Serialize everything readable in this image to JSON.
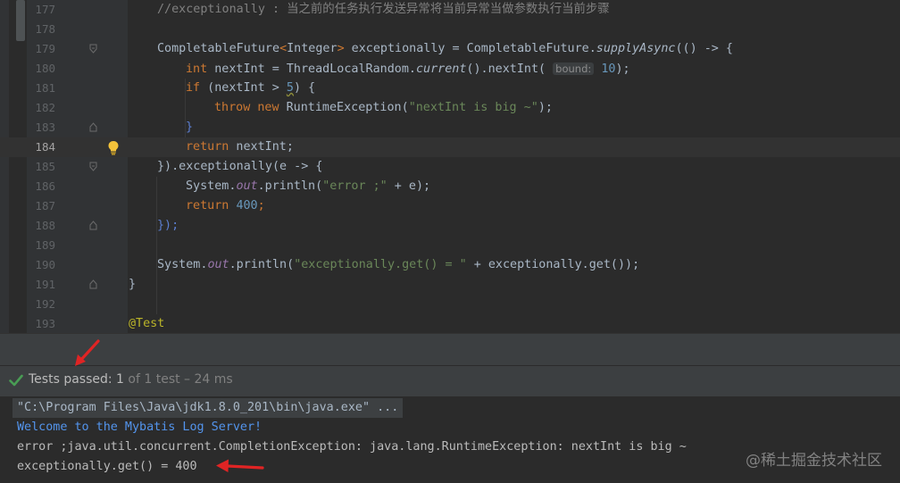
{
  "editor": {
    "lines": [
      {
        "num": "177"
      },
      {
        "num": "178"
      },
      {
        "num": "179"
      },
      {
        "num": "180"
      },
      {
        "num": "181"
      },
      {
        "num": "182"
      },
      {
        "num": "183"
      },
      {
        "num": "184"
      },
      {
        "num": "185"
      },
      {
        "num": "186"
      },
      {
        "num": "187"
      },
      {
        "num": "188"
      },
      {
        "num": "189"
      },
      {
        "num": "190"
      },
      {
        "num": "191"
      },
      {
        "num": "192"
      },
      {
        "num": "193"
      }
    ],
    "tokens": {
      "l177": "//exceptionally : 当之前的任务执行发送异常将当前异常当做参数执行当前步骤",
      "l179_type": "CompletableFuture",
      "l179_lt": "<",
      "l179_generic": "Integer",
      "l179_gt": ">",
      "l179_rest": " exceptionally = CompletableFuture.",
      "l179_method": "supplyAsync",
      "l179_tail": "(() -> {",
      "l180_kw": "int",
      "l180_mid": " nextInt = ThreadLocalRandom.",
      "l180_method": "current",
      "l180_call": "().nextInt(",
      "l180_hint": "bound:",
      "l180_num": "10",
      "l180_end": ");",
      "l181_kw": "if",
      "l181_mid": " (nextInt > ",
      "l181_num": "5",
      "l181_end": ") {",
      "l182_throw": "throw",
      "l182_new": "new",
      "l182_cls": " RuntimeException(",
      "l182_str": "\"nextInt is big ~\"",
      "l182_end": ");",
      "l183": "}",
      "l184_kw": "return",
      "l184_rest": " nextInt;",
      "l185_pre": "}).exceptionally(e -> {",
      "l186_sys": "System.",
      "l186_out": "out",
      "l186_call": ".println(",
      "l186_str": "\"error ;\"",
      "l186_end": " + e);",
      "l187_kw": "return",
      "l187_num": "400",
      "l187_end": ";",
      "l188": "});",
      "l190_sys": "System.",
      "l190_out": "out",
      "l190_call": ".println(",
      "l190_str": "\"exceptionally.get() = \"",
      "l190_end": " + exceptionally.get());",
      "l191": "}",
      "l193": "@Test"
    }
  },
  "test_status": {
    "icon": "check-icon",
    "label": "Tests passed: ",
    "count": "1",
    "detail": " of 1 test – 24 ms",
    "icon_color": "#499c54"
  },
  "console": {
    "lines": [
      "\"C:\\Program Files\\Java\\jdk1.8.0_201\\bin\\java.exe\" ...",
      "Welcome to the Mybatis Log Server!",
      "error ;java.util.concurrent.CompletionException: java.lang.RuntimeException: nextInt is big ~",
      "exceptionally.get() = 400"
    ]
  },
  "watermark": "@稀土掘金技术社区",
  "accent_colors": {
    "arrow": "#e02424",
    "keyword": "#cc7832",
    "string": "#6a8759",
    "number": "#6897bb",
    "console_link": "#5394ec"
  }
}
